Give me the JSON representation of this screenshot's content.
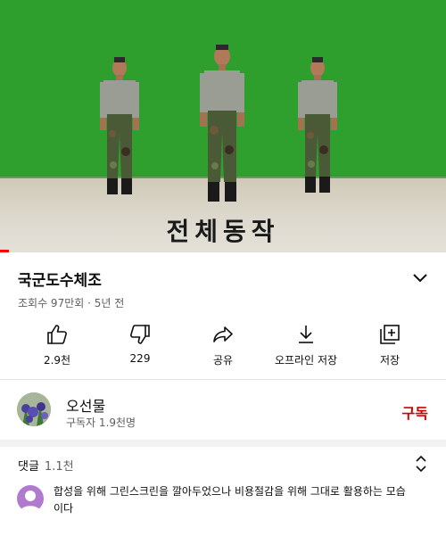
{
  "video": {
    "caption": "전체동작",
    "progress_fraction": 0.02,
    "colors": {
      "chroma": "#2f9f2d",
      "progress": "#ff0000"
    }
  },
  "title": "국군도수체조",
  "meta": "조회수 97만회 · 5년 전",
  "actions": [
    {
      "icon": "thumbs-up-icon",
      "label": "2.9천"
    },
    {
      "icon": "thumbs-down-icon",
      "label": "229"
    },
    {
      "icon": "share-icon",
      "label": "공유"
    },
    {
      "icon": "download-icon",
      "label": "오프라인 저장"
    },
    {
      "icon": "save-playlist-icon",
      "label": "저장"
    }
  ],
  "channel": {
    "name": "오선물",
    "subscribers": "구독자 1.9천명",
    "subscribe_label": "구독"
  },
  "comments": {
    "heading": "댓글",
    "count": "1.1천",
    "top_comment": "합성을 위해 그린스크린을 깔아두었으나 비용절감을 위해 그대로 활용하는 모습이다"
  }
}
